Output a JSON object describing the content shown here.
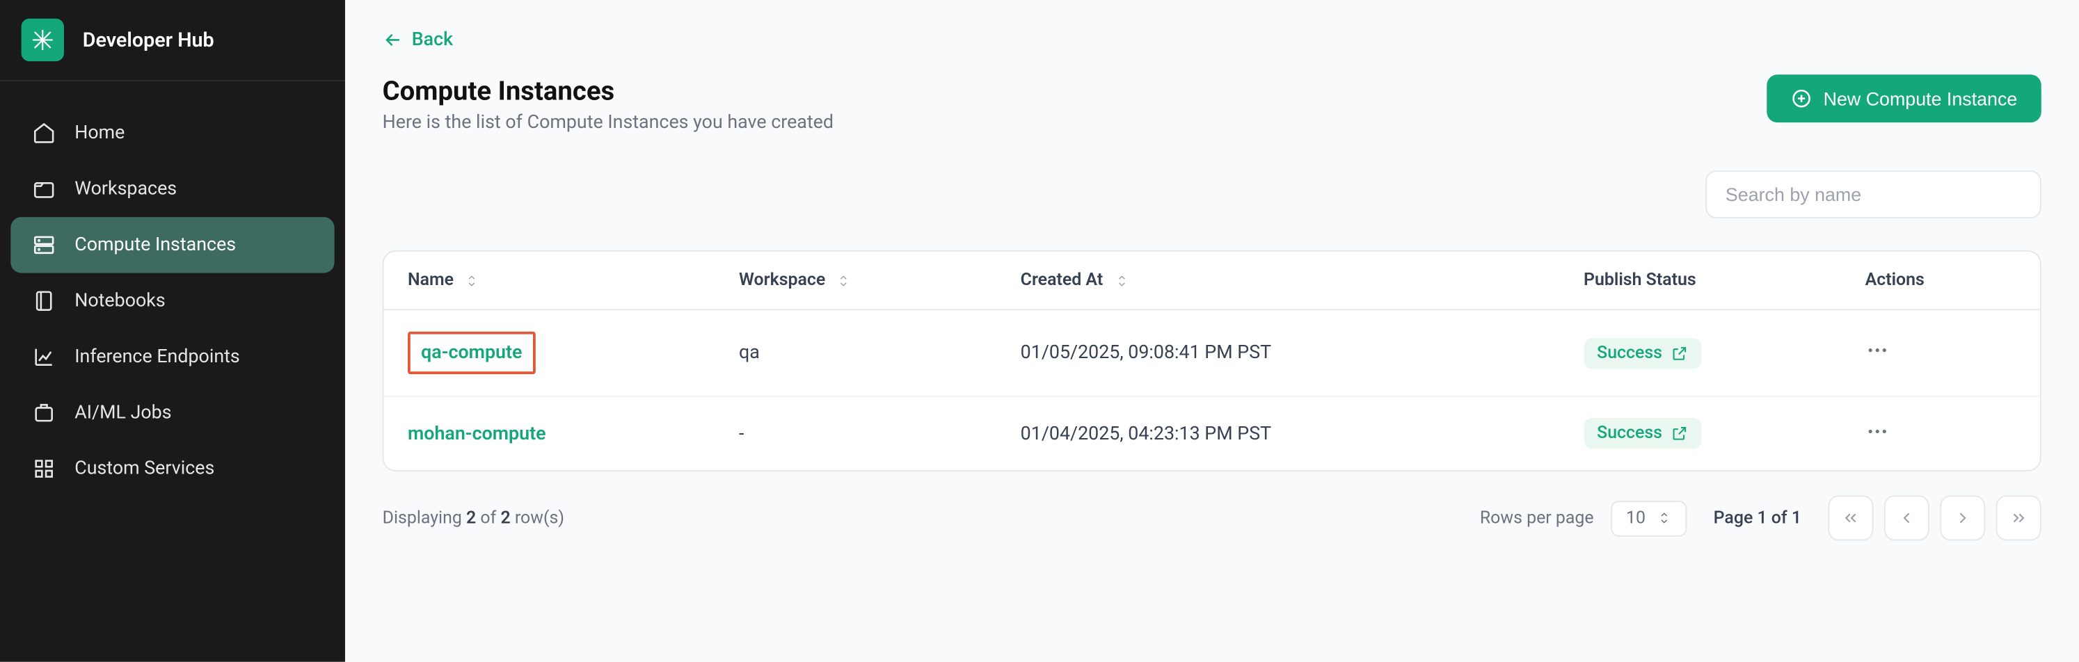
{
  "brand": {
    "title": "Developer Hub"
  },
  "sidebar": {
    "items": [
      {
        "label": "Home"
      },
      {
        "label": "Workspaces"
      },
      {
        "label": "Compute Instances"
      },
      {
        "label": "Notebooks"
      },
      {
        "label": "Inference Endpoints"
      },
      {
        "label": "AI/ML Jobs"
      },
      {
        "label": "Custom Services"
      }
    ]
  },
  "back": {
    "label": "Back"
  },
  "header": {
    "title": "Compute Instances",
    "subtitle": "Here is the list of Compute Instances you have created",
    "new_button": "New Compute Instance"
  },
  "search": {
    "placeholder": "Search by name"
  },
  "table": {
    "columns": {
      "name": "Name",
      "workspace": "Workspace",
      "created": "Created At",
      "status": "Publish Status",
      "actions": "Actions"
    },
    "rows": [
      {
        "name": "qa-compute",
        "workspace": "qa",
        "created": "01/05/2025, 09:08:41 PM PST",
        "status": "Success",
        "highlighted": true
      },
      {
        "name": "mohan-compute",
        "workspace": "-",
        "created": "01/04/2025, 04:23:13 PM PST",
        "status": "Success",
        "highlighted": false
      }
    ]
  },
  "footer": {
    "display_prefix": "Displaying ",
    "count": "2",
    "of_word": " of ",
    "total": "2",
    "rows_suffix": " row(s)",
    "rows_per_page_label": "Rows per page",
    "rows_per_page_value": "10",
    "page_info": "Page 1 of 1"
  }
}
